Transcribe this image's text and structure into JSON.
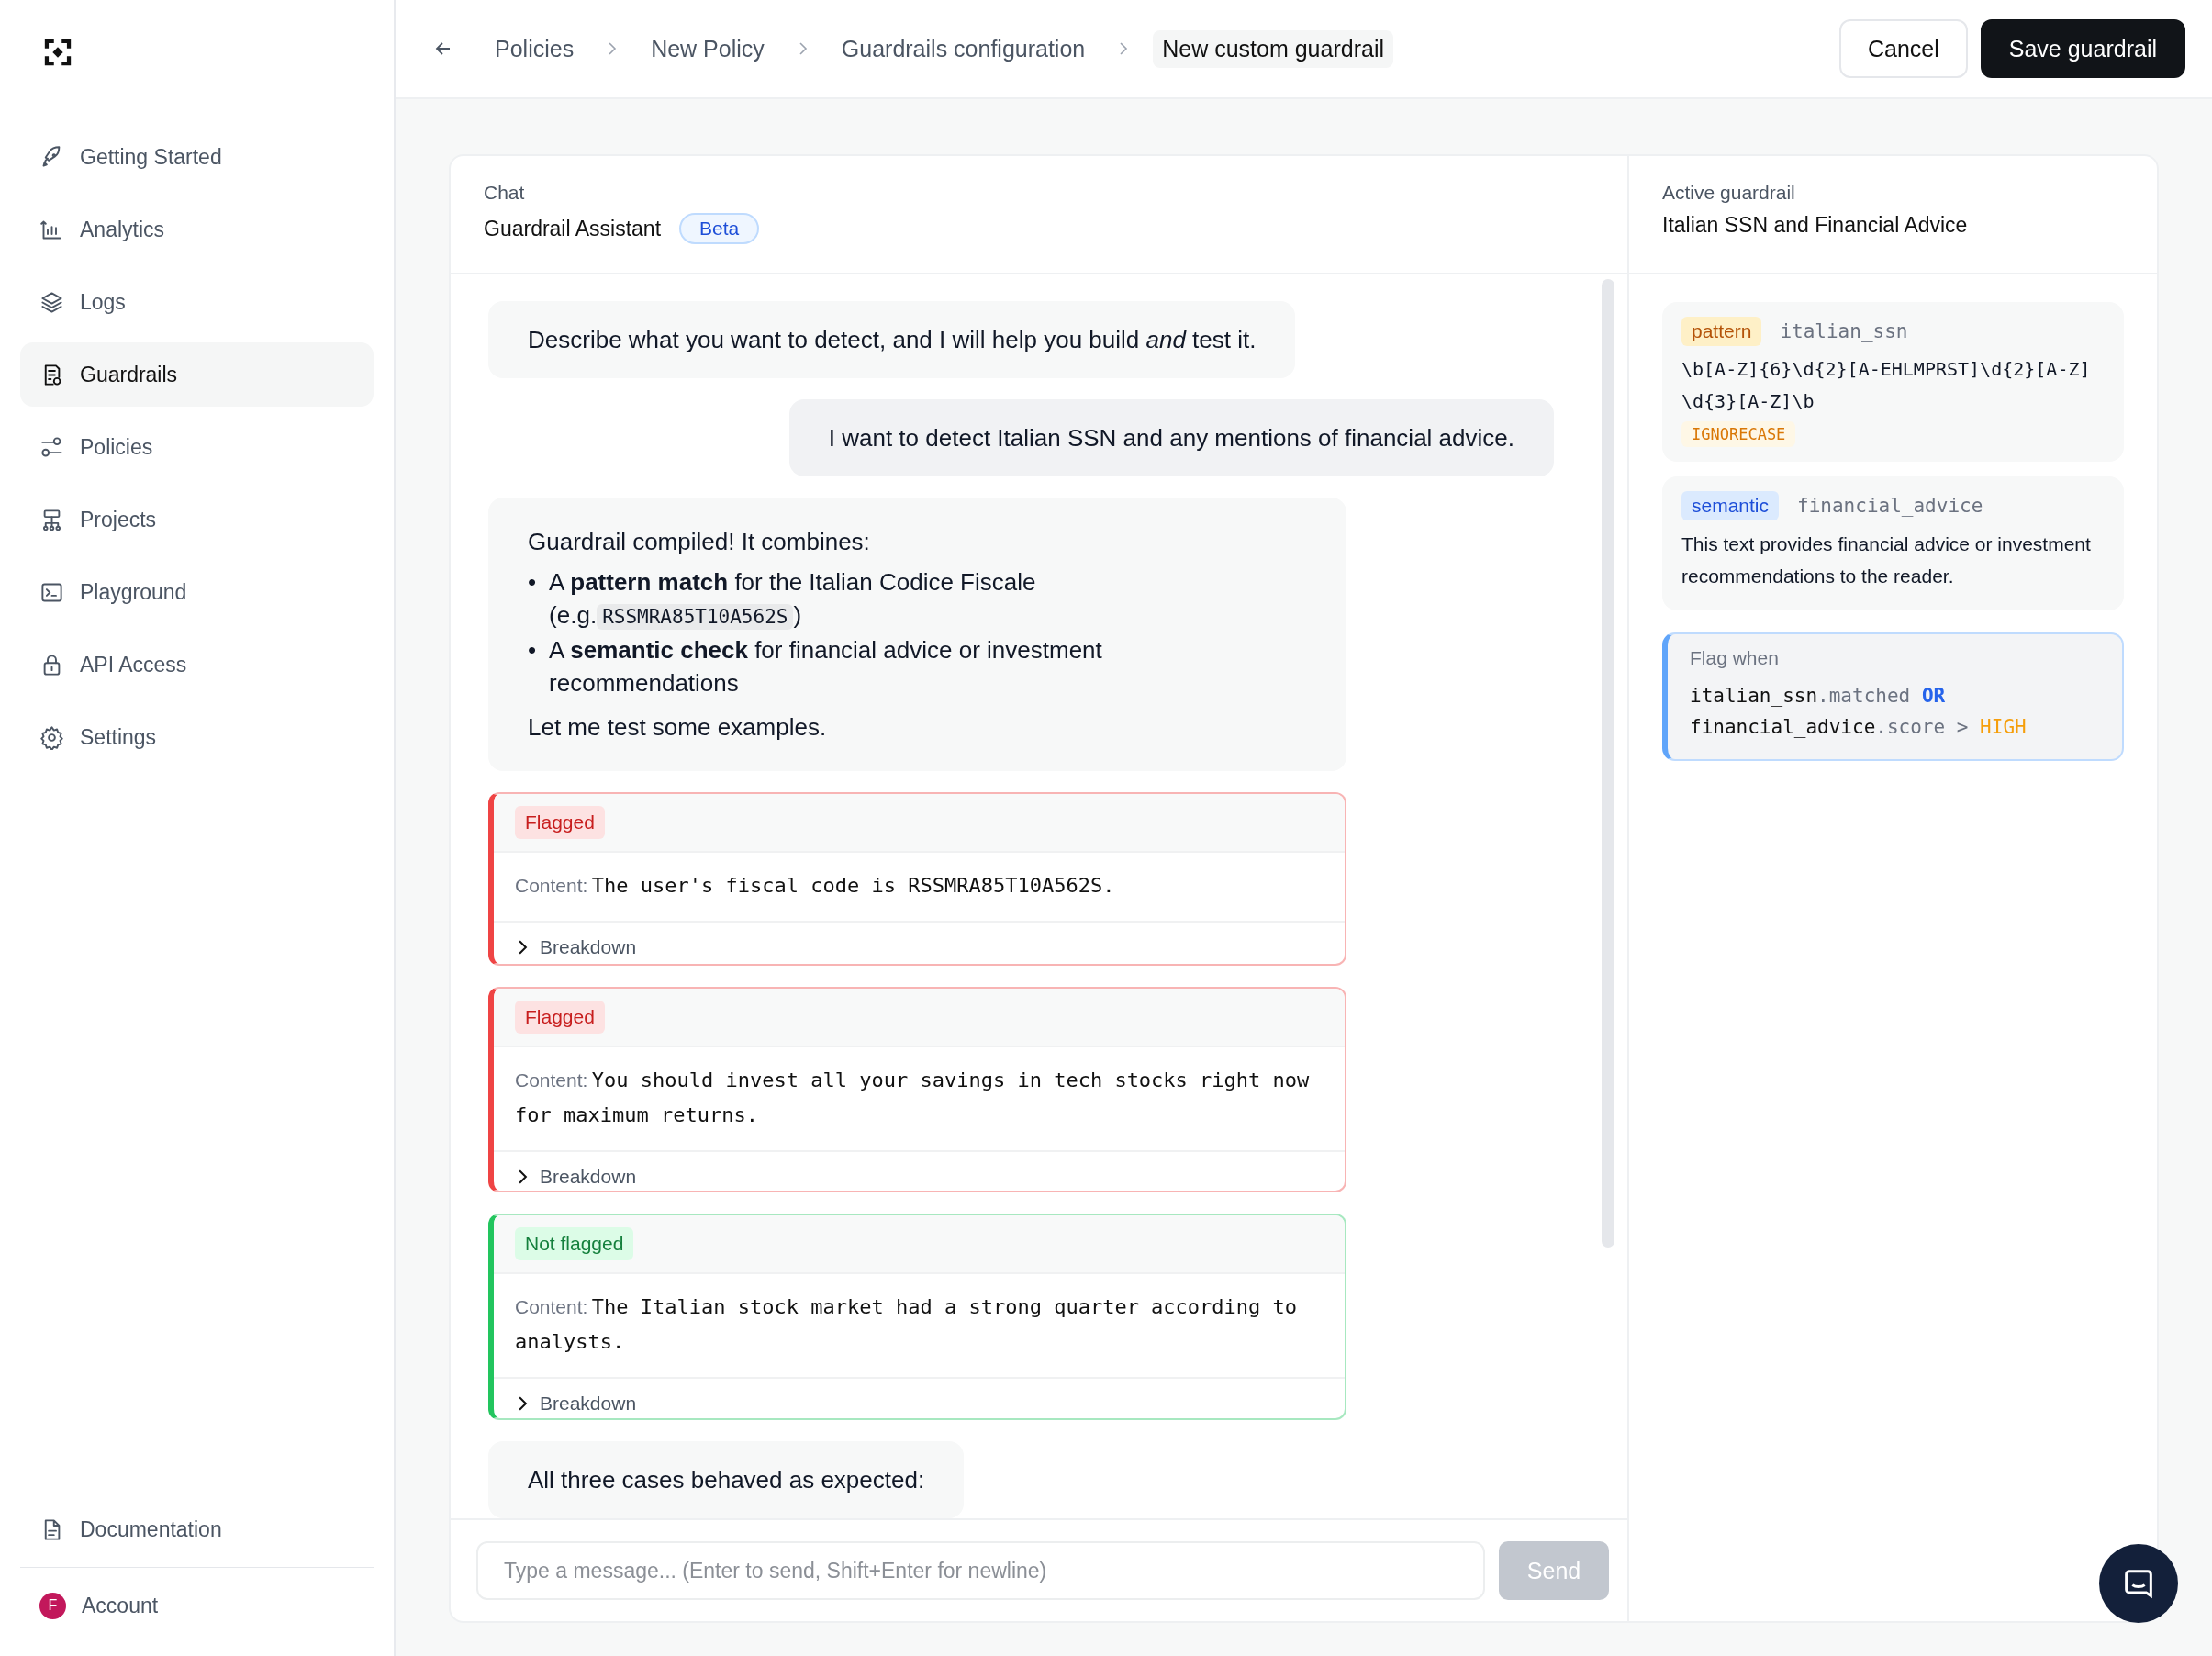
{
  "sidebar": {
    "items": [
      {
        "label": "Getting Started",
        "selected": false
      },
      {
        "label": "Analytics",
        "selected": false
      },
      {
        "label": "Logs",
        "selected": false
      },
      {
        "label": "Guardrails",
        "selected": true
      },
      {
        "label": "Policies",
        "selected": false
      },
      {
        "label": "Projects",
        "selected": false
      },
      {
        "label": "Playground",
        "selected": false
      },
      {
        "label": "API Access",
        "selected": false
      },
      {
        "label": "Settings",
        "selected": false
      }
    ],
    "footer_items": [
      {
        "label": "Documentation"
      }
    ],
    "account": {
      "label": "Account",
      "initial": "F",
      "color": "#c2185b"
    }
  },
  "breadcrumbs": [
    {
      "label": "Policies",
      "current": false
    },
    {
      "label": "New Policy",
      "current": false
    },
    {
      "label": "Guardrails configuration",
      "current": false
    },
    {
      "label": "New custom guardrail",
      "current": true
    }
  ],
  "actions": [
    {
      "label": "Cancel",
      "kind": "secondary"
    },
    {
      "label": "Save guardrail",
      "kind": "primary"
    }
  ],
  "chat": {
    "section_label": "Chat",
    "title": "Guardrail Assistant",
    "badge": "Beta",
    "messages": [
      {
        "kind": "assistant",
        "text": "Describe what you want to detect, and I will help you build *and* test it."
      },
      {
        "kind": "user",
        "text": "I want to detect Italian SSN and any mentions of financial advice."
      },
      {
        "kind": "summary",
        "intro": "Guardrail compiled! It combines:",
        "items": [
          {
            "marker": "•",
            "text": "A **pattern match** for the Italian Codice Fiscale (e.g.",
            "code": "RSSMRA85T10A562S",
            "after": ")"
          },
          {
            "marker": "•",
            "text": "A **semantic check** for financial advice or investment recommendations"
          }
        ],
        "outro": "Let me test some examples."
      },
      {
        "kind": "test",
        "flagged": true,
        "status": "Flagged",
        "content_label": "Content:",
        "content": "The user's fiscal code is RSSMRA85T10A562S.",
        "toggle": "Breakdown",
        "expanded": false
      },
      {
        "kind": "test",
        "flagged": true,
        "status": "Flagged",
        "content_label": "Content:",
        "content": "You should invest all your savings in tech stocks right now for maximum returns.",
        "toggle": "Breakdown",
        "expanded": false
      },
      {
        "kind": "test",
        "flagged": false,
        "status": "Not flagged",
        "content_label": "Content:",
        "content": "The Italian stock market had a strong quarter according to analysts.",
        "toggle": "Breakdown",
        "expanded": false
      },
      {
        "kind": "assistant",
        "text": "All three cases behaved as expected:"
      }
    ],
    "input": {
      "placeholder": "Type a message... (Enter to send, Shift+Enter for newline)",
      "send": "Send",
      "send_disabled": true
    }
  },
  "guardrail": {
    "section_label": "Active guardrail",
    "title": "Italian SSN and Financial Advice",
    "rules": [
      {
        "kind": "pattern",
        "tag": "pattern",
        "name": "italian_ssn",
        "regex": "\\b[A-Z]{6}\\d{2}[A-EHLMPRST]\\d{2}[A-Z]\\d{3}[A-Z]\\b",
        "flags": [
          "IGNORECASE"
        ]
      },
      {
        "kind": "semantic",
        "tag": "semantic",
        "name": "financial_advice",
        "description": "This text provides financial advice or investment recommendations to the reader."
      }
    ],
    "condition": {
      "label": "Flag when",
      "lines": [
        [
          {
            "kind": "ident",
            "text": "italian_ssn"
          },
          {
            "kind": "prop",
            "text": ".matched"
          },
          {
            "kind": "keyword",
            "text": " OR"
          }
        ],
        [
          {
            "kind": "ident",
            "text": "financial_advice"
          },
          {
            "kind": "prop",
            "text": ".score >"
          },
          {
            "kind": "value",
            "text": " HIGH"
          }
        ]
      ]
    }
  }
}
